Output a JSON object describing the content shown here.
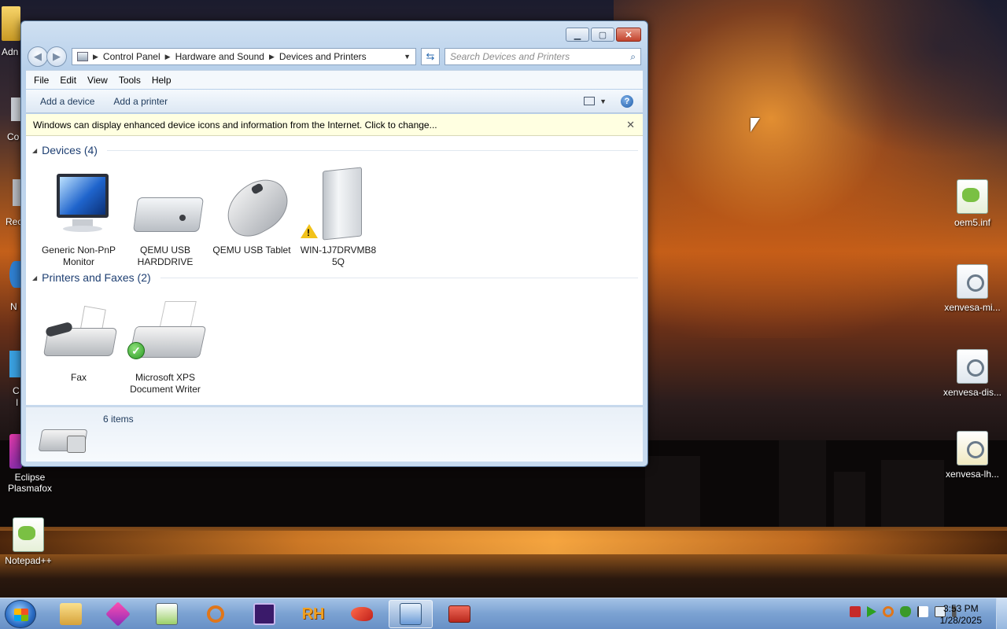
{
  "desktop": {
    "left_partial_labels": [
      "Adn",
      "Co",
      "Rec",
      "N",
      "C",
      "I"
    ],
    "left_icons": [
      {
        "label": "Eclipse Plasmafox"
      },
      {
        "label": "Notepad++"
      }
    ],
    "right_icons": [
      {
        "label": "oem5.inf"
      },
      {
        "label": "xenvesa-mi..."
      },
      {
        "label": "xenvesa-dis..."
      },
      {
        "label": "xenvesa-lh..."
      }
    ]
  },
  "window": {
    "breadcrumb": [
      "Control Panel",
      "Hardware and Sound",
      "Devices and Printers"
    ],
    "search_placeholder": "Search Devices and Printers",
    "menu": [
      "File",
      "Edit",
      "View",
      "Tools",
      "Help"
    ],
    "commands": {
      "add_device": "Add a device",
      "add_printer": "Add a printer"
    },
    "infobar": "Windows can display enhanced device icons and information from the Internet. Click to change...",
    "groups": [
      {
        "title": "Devices (4)",
        "items": [
          {
            "label": "Generic Non-PnP Monitor",
            "icon": "monitor-icon"
          },
          {
            "label": "QEMU USB HARDDRIVE",
            "icon": "hard-drive-icon"
          },
          {
            "label": "QEMU USB Tablet",
            "icon": "mouse-icon"
          },
          {
            "label": "WIN-1J7DRVMB8 5Q",
            "icon": "computer-tower-icon",
            "status": "warning"
          }
        ]
      },
      {
        "title": "Printers and Faxes (2)",
        "items": [
          {
            "label": "Fax",
            "icon": "fax-icon"
          },
          {
            "label": "Microsoft XPS Document Writer",
            "icon": "printer-icon",
            "status": "default"
          }
        ]
      }
    ],
    "details": {
      "count": "6 items"
    }
  },
  "taskbar": {
    "apps": [
      "explorer",
      "plasmafox",
      "notepad++",
      "search-tool",
      "cpu-tool",
      "rh-tool",
      "chili-tool",
      "control-panel",
      "toolbox"
    ],
    "active": "control-panel",
    "clock_time": "3:53 PM",
    "clock_date": "1/28/2025"
  }
}
